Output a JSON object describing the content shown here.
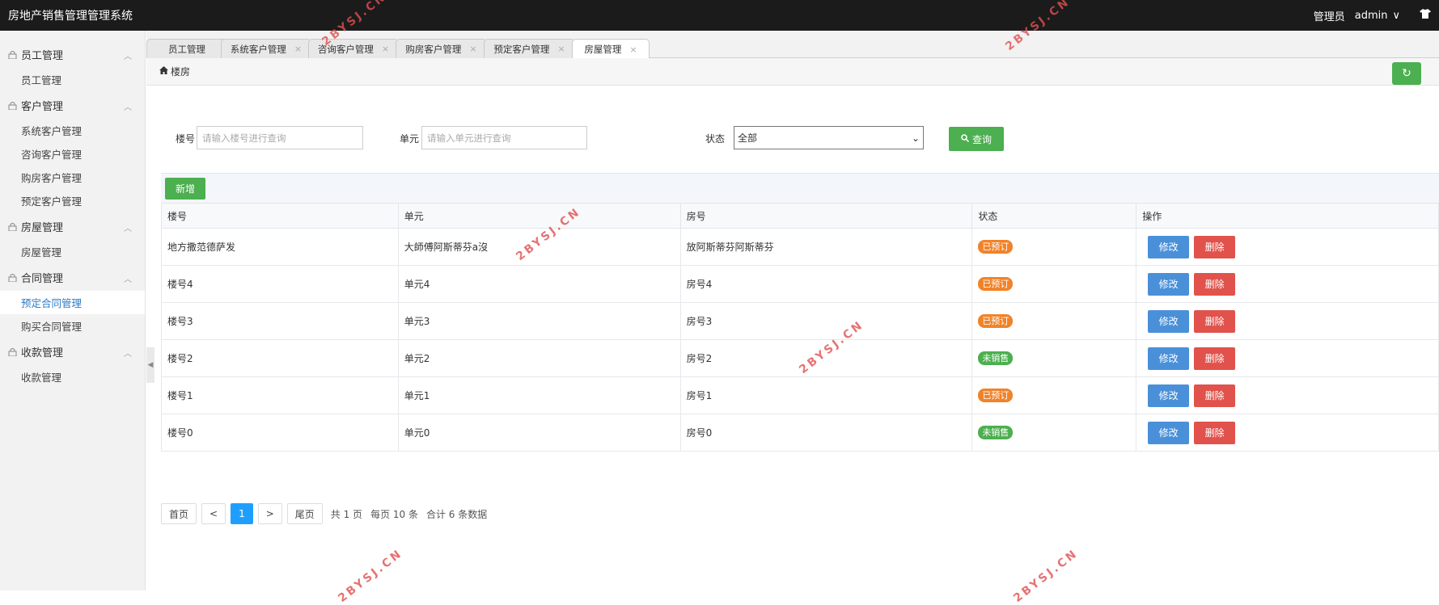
{
  "app": {
    "title": "房地产销售管理管理系统"
  },
  "topbar": {
    "role": "管理员",
    "username": "admin",
    "dropdown_glyph": "∨",
    "shirt_icon": "shirt-icon"
  },
  "sidebar": {
    "groups": [
      {
        "title": "员工管理",
        "items": [
          "员工管理"
        ]
      },
      {
        "title": "客户管理",
        "items": [
          "系统客户管理",
          "咨询客户管理",
          "购房客户管理",
          "预定客户管理"
        ]
      },
      {
        "title": "房屋管理",
        "items": [
          "房屋管理"
        ]
      },
      {
        "title": "合同管理",
        "items": [
          "预定合同管理",
          "购买合同管理"
        ]
      },
      {
        "title": "收款管理",
        "items": [
          "收款管理"
        ]
      }
    ],
    "active_item": "预定合同管理"
  },
  "tabs": [
    {
      "label": "员工管理",
      "closable": false
    },
    {
      "label": "系统客户管理",
      "closable": true
    },
    {
      "label": "咨询客户管理",
      "closable": true
    },
    {
      "label": "购房客户管理",
      "closable": true
    },
    {
      "label": "预定客户管理",
      "closable": true
    },
    {
      "label": "房屋管理",
      "closable": true,
      "active": true
    }
  ],
  "breadcrumb": {
    "label": "楼房"
  },
  "search": {
    "building_label": "楼号",
    "building_placeholder": "请输入楼号进行查询",
    "unit_label": "单元",
    "unit_placeholder": "请输入单元进行查询",
    "status_label": "状态",
    "status_value": "全部",
    "query_label": "查询"
  },
  "toolbar": {
    "add_label": "新增"
  },
  "table": {
    "headers": [
      "楼号",
      "单元",
      "房号",
      "状态",
      "操作"
    ],
    "rows": [
      {
        "building": "地方撒范德萨发",
        "unit": "大師傅阿斯蒂芬a沒",
        "room": "放阿斯蒂芬阿斯蒂芬",
        "status": "已预订",
        "status_type": "booked"
      },
      {
        "building": "楼号4",
        "unit": "单元4",
        "room": "房号4",
        "status": "已预订",
        "status_type": "booked"
      },
      {
        "building": "楼号3",
        "unit": "单元3",
        "room": "房号3",
        "status": "已预订",
        "status_type": "booked"
      },
      {
        "building": "楼号2",
        "unit": "单元2",
        "room": "房号2",
        "status": "未销售",
        "status_type": "unsold"
      },
      {
        "building": "楼号1",
        "unit": "单元1",
        "room": "房号1",
        "status": "已预订",
        "status_type": "booked"
      },
      {
        "building": "楼号0",
        "unit": "单元0",
        "room": "房号0",
        "status": "未销售",
        "status_type": "unsold"
      }
    ],
    "edit_label": "修改",
    "delete_label": "删除"
  },
  "pager": {
    "first": "首页",
    "prev": "<",
    "current": "1",
    "next": ">",
    "last": "尾页",
    "total_pages": "共 1 页",
    "per_page": "每页 10 条",
    "total": "合计 6 条数据"
  },
  "watermark": "2BYSJ.CN",
  "colors": {
    "primary_green": "#4caf50",
    "edit_blue": "#4a90d9",
    "delete_red": "#e0524b",
    "booked_orange": "#f0832a",
    "topbar": "#1b1b1b"
  }
}
